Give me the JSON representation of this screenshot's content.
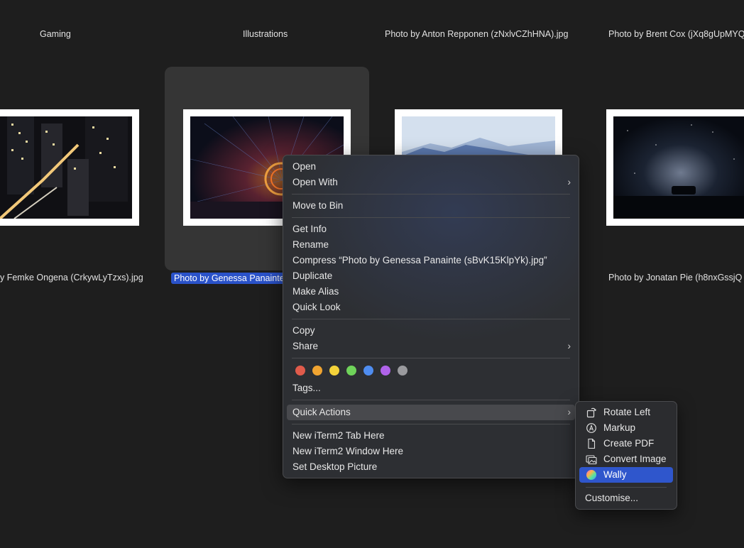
{
  "grid": {
    "top_labels": [
      "Gaming",
      "Illustrations",
      "Photo by Anton Repponen (zNxlvCZhHNA).jpg",
      "Photo by Brent Cox (jXq8gUpMYQ"
    ],
    "file_labels": [
      "y Femke Ongena (CrkywLyTzxs).jpg",
      "Photo by Genessa Panainte",
      "Photo by Jonatan Pie (h8nxGssjQ"
    ],
    "selected_label": "Photo by Genessa Panainte"
  },
  "context_menu": {
    "open": "Open",
    "open_with": "Open With",
    "move_to_bin": "Move to Bin",
    "get_info": "Get Info",
    "rename": "Rename",
    "compress": "Compress “Photo by Genessa Panainte (sBvK15KlpYk).jpg”",
    "duplicate": "Duplicate",
    "make_alias": "Make Alias",
    "quick_look": "Quick Look",
    "copy": "Copy",
    "share": "Share",
    "tags": "Tags...",
    "quick_actions": "Quick Actions",
    "new_iterm_tab": "New iTerm2 Tab Here",
    "new_iterm_window": "New iTerm2 Window Here",
    "set_desktop": "Set Desktop Picture",
    "chevron": "›"
  },
  "tag_colors": [
    "#e05b4b",
    "#f0a431",
    "#f5d33a",
    "#6fd35a",
    "#4f8df0",
    "#b063ea",
    "#9a9a9e"
  ],
  "quick_actions_menu": {
    "rotate_left": "Rotate Left",
    "markup": "Markup",
    "create_pdf": "Create PDF",
    "convert_image": "Convert Image",
    "wally": "Wally",
    "customise": "Customise..."
  },
  "colors": {
    "selection": "#2a52c9",
    "submenu_active": "#2f56cc"
  }
}
